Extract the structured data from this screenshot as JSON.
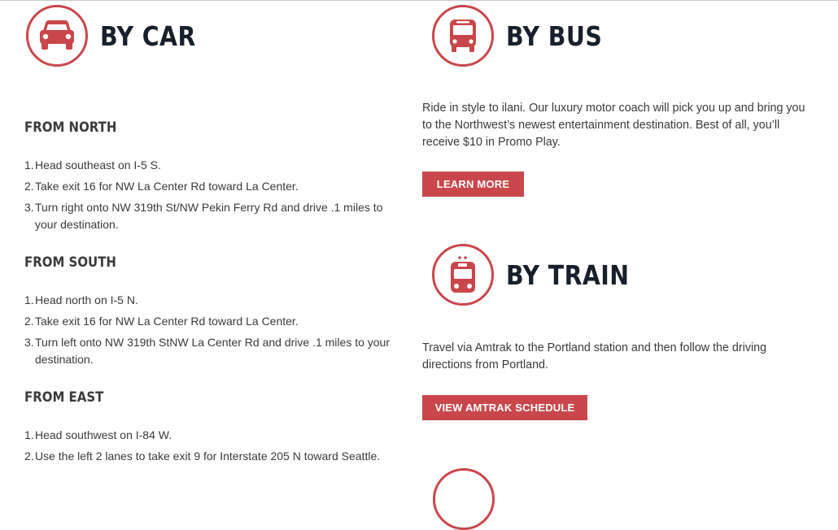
{
  "colors": {
    "accent": "#c9474b",
    "heading": "#17202b",
    "text": "#3a3a3a"
  },
  "car": {
    "icon": "car-icon",
    "title": "BY CAR",
    "sections": [
      {
        "heading": "FROM NORTH",
        "steps": [
          "Head southeast on I-5 S.",
          "Take exit 16 for NW La Center Rd toward La Center.",
          "Turn right onto NW 319th St/NW Pekin Ferry Rd and drive .1 miles to your destination."
        ]
      },
      {
        "heading": "FROM SOUTH",
        "steps": [
          "Head north on I-5 N.",
          "Take exit 16 for NW La Center Rd toward La Center.",
          "Turn left onto NW 319th StNW La Center Rd and drive .1 miles to your destination."
        ]
      },
      {
        "heading": "FROM EAST",
        "steps": [
          "Head southwest on I-84 W.",
          "Use the left 2 lanes to take exit 9 for Interstate 205 N toward Seattle."
        ]
      }
    ]
  },
  "bus": {
    "icon": "bus-icon",
    "title": "BY BUS",
    "description": "Ride in style to ilani. Our luxury motor coach will pick you up and bring you to the Northwest’s newest entertainment destination. Best of all, you’ll receive $10 in Promo Play.",
    "button_label": "LEARN MORE"
  },
  "train": {
    "icon": "train-icon",
    "title": "BY TRAIN",
    "description": "Travel via Amtrak to the Portland station and then follow the driving directions from Portland.",
    "button_label": "VIEW AMTRAK SCHEDULE"
  }
}
